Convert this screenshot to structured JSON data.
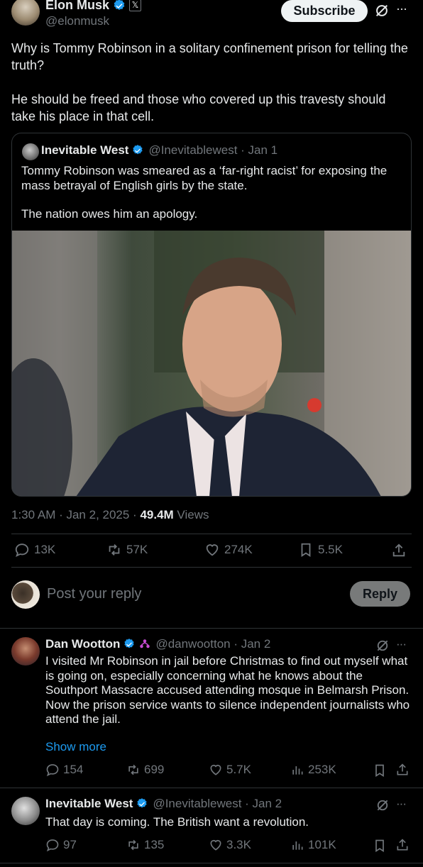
{
  "header": {
    "author_name": "Elon Musk",
    "author_handle": "@elonmusk",
    "subscribe_label": "Subscribe",
    "more_label": "···"
  },
  "tweet": {
    "text_p1": "Why is Tommy Robinson in a solitary confinement prison for telling the truth?",
    "text_p2": "He should be freed and those who covered up this travesty should take his place in that cell.",
    "time": "1:30 AM · Jan 2, 2025 · ",
    "views_count": "49.4M",
    "views_label": " Views"
  },
  "quote": {
    "author_name": "Inevitable West",
    "author_handle": "@Inevitablewest · Jan 1",
    "text_p1": "Tommy Robinson was smeared as a ‘far-right racist’ for exposing the mass betrayal of English girls by the state.",
    "text_p2": "The nation owes him an apology."
  },
  "actions": {
    "replies": "13K",
    "reposts": "57K",
    "likes": "274K",
    "bookmarks": "5.5K"
  },
  "composer": {
    "placeholder": "Post your reply",
    "reply_label": "Reply"
  },
  "replies": [
    {
      "author_name": "Dan Wootton",
      "author_handle": "@danwootton · Jan 2",
      "text": "I visited Mr Robinson in jail before Christmas to find out myself what is going on, especially concerning what he knows about the Southport Massacre accused attending mosque in Belmarsh Prison.\nNow the prison service wants to silence independent journalists who attend the jail.",
      "show_more": "Show more",
      "replies": "154",
      "reposts": "699",
      "likes": "5.7K",
      "views": "253K"
    },
    {
      "author_name": "Inevitable West",
      "author_handle": "@Inevitablewest · Jan 2",
      "text": "That day is coming. The British want a revolution.",
      "replies": "97",
      "reposts": "135",
      "likes": "3.3K",
      "views": "101K"
    }
  ],
  "colors": {
    "background": "#000000",
    "verified": "#1d9bf0",
    "link": "#1d9bf0",
    "muted": "#71767b"
  }
}
